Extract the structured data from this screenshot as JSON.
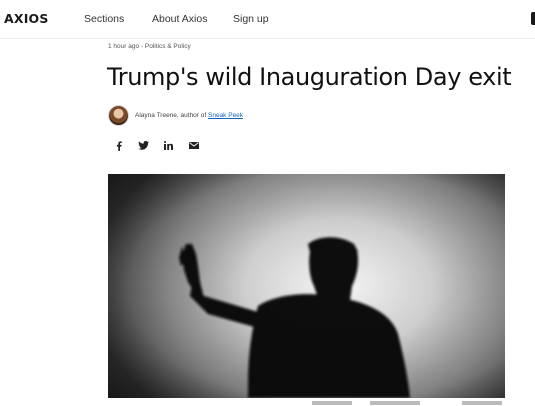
{
  "header": {
    "logo": "AXIOS",
    "nav": {
      "sections": "Sections",
      "about": "About Axios",
      "signup": "Sign up"
    }
  },
  "article": {
    "timestamp": "1 hour ago - Politics & Policy",
    "headline": "Trump's wild Inauguration Day exit",
    "byline": {
      "author_prefix": "Alayna Treene, author of ",
      "newsletter": "Sneak Peek"
    },
    "share_icons": [
      "facebook-icon",
      "twitter-icon",
      "linkedin-icon",
      "email-icon"
    ]
  },
  "colors": {
    "link": "#1565c0",
    "text": "#1a1a1a"
  }
}
